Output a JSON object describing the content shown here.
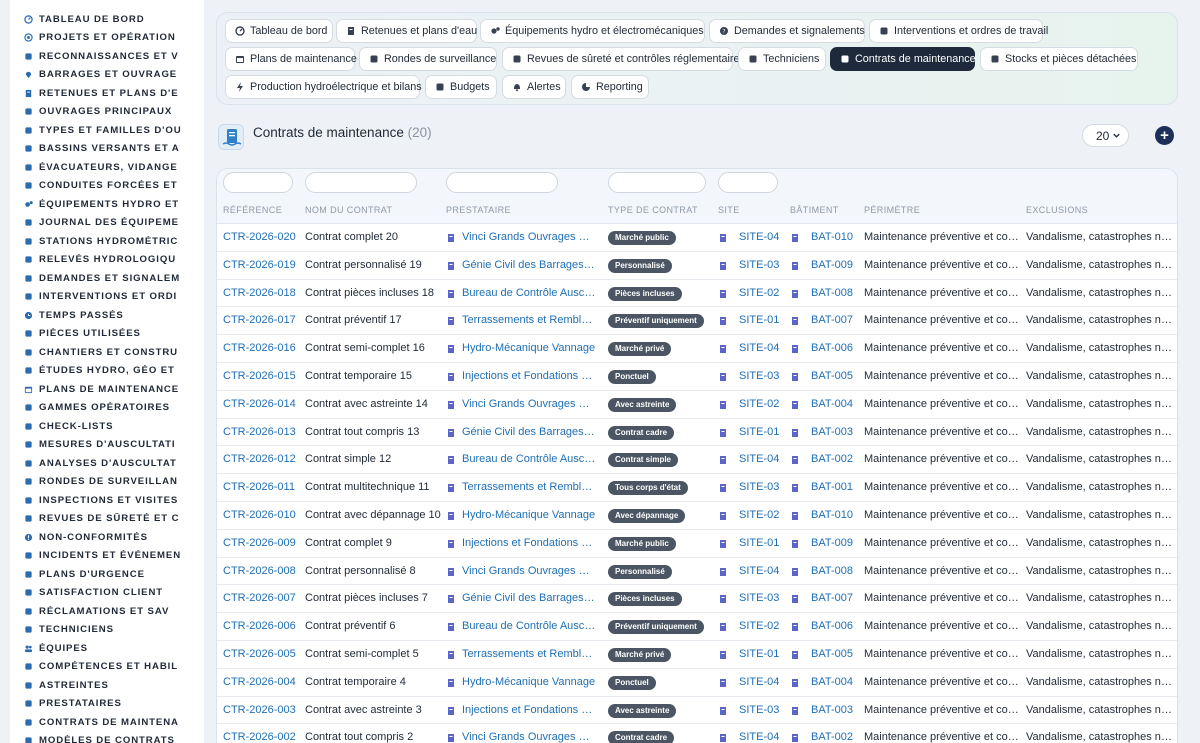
{
  "sidebar": {
    "items": [
      {
        "label": "TABLEAU DE BORD",
        "icon": "dashboard-icon"
      },
      {
        "label": "PROJETS ET OPÉRATION",
        "icon": "target-icon"
      },
      {
        "label": "RECONNAISSANCES ET V",
        "icon": "binoculars-icon"
      },
      {
        "label": "BARRAGES ET OUVRAGE",
        "icon": "map-pin-icon"
      },
      {
        "label": "RETENUES ET PLANS D'E",
        "icon": "building-icon"
      },
      {
        "label": "OUVRAGES PRINCIPAUX",
        "icon": "layers-icon"
      },
      {
        "label": "TYPES ET FAMILLES D'OU",
        "icon": "sitemap-icon"
      },
      {
        "label": "BASSINS VERSANTS ET A",
        "icon": "grid-icon"
      },
      {
        "label": "ÉVACUATEURS, VIDANGE",
        "icon": "water-icon"
      },
      {
        "label": "CONDUITES FORCÉES ET",
        "icon": "pipe-icon"
      },
      {
        "label": "ÉQUIPEMENTS HYDRO ET",
        "icon": "cogs-icon"
      },
      {
        "label": "JOURNAL DES ÉQUIPEME",
        "icon": "book-icon"
      },
      {
        "label": "STATIONS HYDROMÉTRIC",
        "icon": "gauge-icon"
      },
      {
        "label": "RELEVÉS HYDROLOGIQU",
        "icon": "chart-icon"
      },
      {
        "label": "DEMANDES ET SIGNALEM",
        "icon": "comment-icon"
      },
      {
        "label": "INTERVENTIONS ET ORDI",
        "icon": "clipboard-icon"
      },
      {
        "label": "TEMPS PASSÉS",
        "icon": "clock-icon"
      },
      {
        "label": "PIÈCES UTILISÉES",
        "icon": "box-icon"
      },
      {
        "label": "CHANTIERS ET CONSTRU",
        "icon": "hammer-icon"
      },
      {
        "label": "ÉTUDES HYDRO, GÉO ET",
        "icon": "flask-icon"
      },
      {
        "label": "PLANS DE MAINTENANCE",
        "icon": "calendar-icon"
      },
      {
        "label": "GAMMES OPÉRATOIRES",
        "icon": "list-icon"
      },
      {
        "label": "CHECK-LISTS",
        "icon": "check-icon"
      },
      {
        "label": "MESURES D'AUSCULTATI",
        "icon": "ruler-icon"
      },
      {
        "label": "ANALYSES D'AUSCULTAT",
        "icon": "analytics-icon"
      },
      {
        "label": "RONDES DE SURVEILLAN",
        "icon": "route-icon"
      },
      {
        "label": "INSPECTIONS ET VISITES",
        "icon": "search-icon"
      },
      {
        "label": "REVUES DE SÛRETÉ ET C",
        "icon": "shield-icon"
      },
      {
        "label": "NON-CONFORMITÉS",
        "icon": "alert-icon"
      },
      {
        "label": "INCIDENTS ET ÉVÉNEMEN",
        "icon": "warning-icon"
      },
      {
        "label": "PLANS D'URGENCE",
        "icon": "flag-icon"
      },
      {
        "label": "SATISFACTION CLIENT",
        "icon": "smile-icon"
      },
      {
        "label": "RÉCLAMATIONS ET SAV",
        "icon": "chat-icon"
      },
      {
        "label": "TECHNICIENS",
        "icon": "helmet-icon"
      },
      {
        "label": "ÉQUIPES",
        "icon": "users-icon"
      },
      {
        "label": "COMPÉTENCES ET HABIL",
        "icon": "star-icon"
      },
      {
        "label": "ASTREINTES",
        "icon": "phone-icon"
      },
      {
        "label": "PRESTATAIRES",
        "icon": "handshake-icon"
      },
      {
        "label": "CONTRATS DE MAINTENA",
        "icon": "file-contract-icon"
      },
      {
        "label": "MODÈLES DE CONTRATS",
        "icon": "template-icon"
      }
    ]
  },
  "tabs": [
    {
      "label": "Tableau de bord",
      "icon": "dashboard-icon"
    },
    {
      "label": "Retenues et plans d'eau",
      "icon": "building-icon"
    },
    {
      "label": "Équipements hydro et électromécaniques",
      "icon": "cogs-icon"
    },
    {
      "label": "Demandes et signalements",
      "icon": "question-icon"
    },
    {
      "label": "Interventions et ordres de travail",
      "icon": "clipboard-icon"
    },
    {
      "label": "Plans de maintenance",
      "icon": "calendar-icon"
    },
    {
      "label": "Rondes de surveillance",
      "icon": "route-icon"
    },
    {
      "label": "Revues de sûreté et contrôles réglementaires",
      "icon": "shield-icon"
    },
    {
      "label": "Techniciens",
      "icon": "helmet-icon"
    },
    {
      "label": "Contrats de maintenance",
      "icon": "file-contract-icon",
      "active": true
    },
    {
      "label": "Stocks et pièces détachées",
      "icon": "boxes-icon"
    },
    {
      "label": "Production hydroélectrique et bilans",
      "icon": "bolt-icon"
    },
    {
      "label": "Budgets",
      "icon": "money-icon"
    },
    {
      "label": "Alertes",
      "icon": "bell-icon"
    },
    {
      "label": "Reporting",
      "icon": "pie-icon"
    }
  ],
  "header": {
    "title": "Contrats de maintenance",
    "count": "(20)",
    "page_size": "20",
    "add_label": "+"
  },
  "columns": [
    "RÉFÉRENCE",
    "NOM DU CONTRAT",
    "PRESTATAIRE",
    "TYPE DE CONTRAT",
    "SITE",
    "BÂTIMENT",
    "PÉRIMÈTRE",
    "EXCLUSIONS"
  ],
  "rows": [
    {
      "ref": "CTR-2026-020",
      "name": "Contrat complet 20",
      "provider": "Vinci Grands Ouvrages H…",
      "type": "Marché public",
      "site": "SITE-04",
      "building": "BAT-010",
      "scope": "Maintenance préventive et co…",
      "exclusions": "Vandalisme, catastrophes nat…"
    },
    {
      "ref": "CTR-2026-019",
      "name": "Contrat personnalisé 19",
      "provider": "Génie Civil des Barrages SA",
      "type": "Personnalisé",
      "site": "SITE-03",
      "building": "BAT-009",
      "scope": "Maintenance préventive et co…",
      "exclusions": "Vandalisme, catastrophes nat…"
    },
    {
      "ref": "CTR-2026-018",
      "name": "Contrat pièces incluses 18",
      "provider": "Bureau de Contrôle Auscu…",
      "type": "Pièces incluses",
      "site": "SITE-02",
      "building": "BAT-008",
      "scope": "Maintenance préventive et co…",
      "exclusions": "Vandalisme, catastrophes nat…"
    },
    {
      "ref": "CTR-2026-017",
      "name": "Contrat préventif 17",
      "provider": "Terrassements et Remblai…",
      "type": "Préventif uniquement",
      "site": "SITE-01",
      "building": "BAT-007",
      "scope": "Maintenance préventive et co…",
      "exclusions": "Vandalisme, catastrophes nat…"
    },
    {
      "ref": "CTR-2026-016",
      "name": "Contrat semi-complet 16",
      "provider": "Hydro-Mécanique Vannage",
      "type": "Marché privé",
      "site": "SITE-04",
      "building": "BAT-006",
      "scope": "Maintenance préventive et co…",
      "exclusions": "Vandalisme, catastrophes nat…"
    },
    {
      "ref": "CTR-2026-015",
      "name": "Contrat temporaire 15",
      "provider": "Injections et Fondations S…",
      "type": "Ponctuel",
      "site": "SITE-03",
      "building": "BAT-005",
      "scope": "Maintenance préventive et co…",
      "exclusions": "Vandalisme, catastrophes nat…"
    },
    {
      "ref": "CTR-2026-014",
      "name": "Contrat avec astreinte 14",
      "provider": "Vinci Grands Ouvrages H…",
      "type": "Avec astreinte",
      "site": "SITE-02",
      "building": "BAT-004",
      "scope": "Maintenance préventive et co…",
      "exclusions": "Vandalisme, catastrophes nat…"
    },
    {
      "ref": "CTR-2026-013",
      "name": "Contrat tout compris 13",
      "provider": "Génie Civil des Barrages SA",
      "type": "Contrat cadre",
      "site": "SITE-01",
      "building": "BAT-003",
      "scope": "Maintenance préventive et co…",
      "exclusions": "Vandalisme, catastrophes nat…"
    },
    {
      "ref": "CTR-2026-012",
      "name": "Contrat simple 12",
      "provider": "Bureau de Contrôle Auscu…",
      "type": "Contrat simple",
      "site": "SITE-04",
      "building": "BAT-002",
      "scope": "Maintenance préventive et co…",
      "exclusions": "Vandalisme, catastrophes nat…"
    },
    {
      "ref": "CTR-2026-011",
      "name": "Contrat multitechnique 11",
      "provider": "Terrassements et Remblai…",
      "type": "Tous corps d'état",
      "site": "SITE-03",
      "building": "BAT-001",
      "scope": "Maintenance préventive et co…",
      "exclusions": "Vandalisme, catastrophes nat…"
    },
    {
      "ref": "CTR-2026-010",
      "name": "Contrat avec dépannage 10",
      "provider": "Hydro-Mécanique Vannage",
      "type": "Avec dépannage",
      "site": "SITE-02",
      "building": "BAT-010",
      "scope": "Maintenance préventive et co…",
      "exclusions": "Vandalisme, catastrophes nat…"
    },
    {
      "ref": "CTR-2026-009",
      "name": "Contrat complet 9",
      "provider": "Injections et Fondations S…",
      "type": "Marché public",
      "site": "SITE-01",
      "building": "BAT-009",
      "scope": "Maintenance préventive et co…",
      "exclusions": "Vandalisme, catastrophes nat…"
    },
    {
      "ref": "CTR-2026-008",
      "name": "Contrat personnalisé 8",
      "provider": "Vinci Grands Ouvrages H…",
      "type": "Personnalisé",
      "site": "SITE-04",
      "building": "BAT-008",
      "scope": "Maintenance préventive et co…",
      "exclusions": "Vandalisme, catastrophes nat…"
    },
    {
      "ref": "CTR-2026-007",
      "name": "Contrat pièces incluses 7",
      "provider": "Génie Civil des Barrages SA",
      "type": "Pièces incluses",
      "site": "SITE-03",
      "building": "BAT-007",
      "scope": "Maintenance préventive et co…",
      "exclusions": "Vandalisme, catastrophes nat…"
    },
    {
      "ref": "CTR-2026-006",
      "name": "Contrat préventif 6",
      "provider": "Bureau de Contrôle Auscu…",
      "type": "Préventif uniquement",
      "site": "SITE-02",
      "building": "BAT-006",
      "scope": "Maintenance préventive et co…",
      "exclusions": "Vandalisme, catastrophes nat…"
    },
    {
      "ref": "CTR-2026-005",
      "name": "Contrat semi-complet 5",
      "provider": "Terrassements et Remblai…",
      "type": "Marché privé",
      "site": "SITE-01",
      "building": "BAT-005",
      "scope": "Maintenance préventive et co…",
      "exclusions": "Vandalisme, catastrophes nat…"
    },
    {
      "ref": "CTR-2026-004",
      "name": "Contrat temporaire 4",
      "provider": "Hydro-Mécanique Vannage",
      "type": "Ponctuel",
      "site": "SITE-04",
      "building": "BAT-004",
      "scope": "Maintenance préventive et co…",
      "exclusions": "Vandalisme, catastrophes nat…"
    },
    {
      "ref": "CTR-2026-003",
      "name": "Contrat avec astreinte 3",
      "provider": "Injections et Fondations S…",
      "type": "Avec astreinte",
      "site": "SITE-03",
      "building": "BAT-003",
      "scope": "Maintenance préventive et co…",
      "exclusions": "Vandalisme, catastrophes nat…"
    },
    {
      "ref": "CTR-2026-002",
      "name": "Contrat tout compris 2",
      "provider": "Vinci Grands Ouvrages H…",
      "type": "Contrat cadre",
      "site": "SITE-04",
      "building": "BAT-002",
      "scope": "Maintenance préventive et co…",
      "exclusions": "Vandalisme, catastrophes nat…"
    }
  ],
  "colors": {
    "accent": "#1f6fb5",
    "dark": "#1e293b",
    "badge": "#4b5563",
    "sidebar_icon": "#2b6cb0"
  }
}
